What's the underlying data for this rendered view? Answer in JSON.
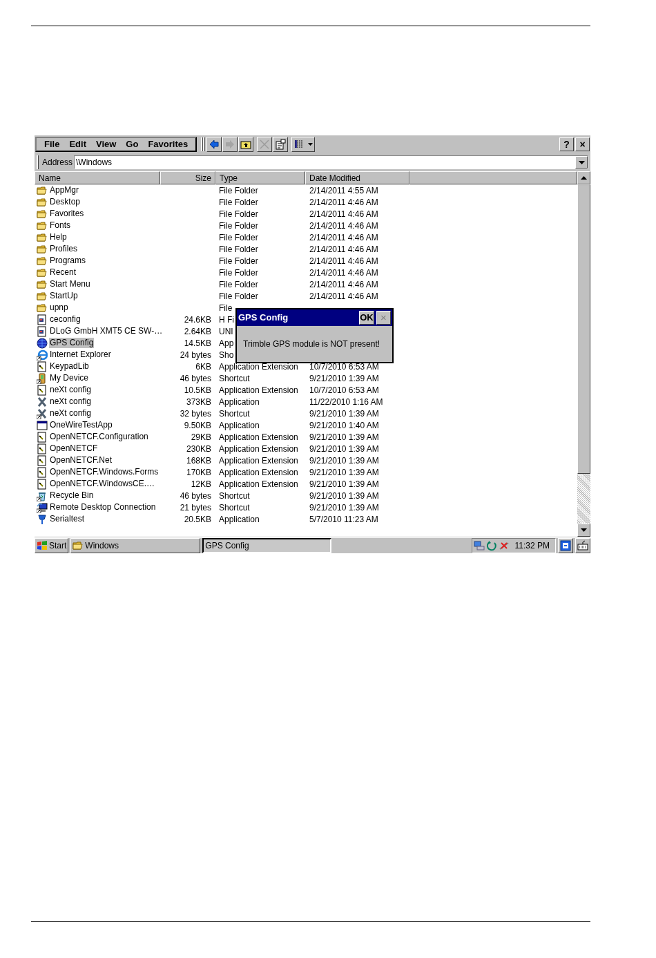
{
  "menu": [
    "File",
    "Edit",
    "View",
    "Go",
    "Favorites"
  ],
  "toolbar": [
    {
      "kind": "back",
      "disabled": false
    },
    {
      "kind": "forward",
      "disabled": true
    },
    {
      "kind": "up",
      "disabled": false
    },
    {
      "kind": "delete",
      "disabled": true
    },
    {
      "kind": "properties",
      "disabled": false
    },
    {
      "kind": "views",
      "disabled": false
    }
  ],
  "window_buttons": [
    "?",
    "×"
  ],
  "address": {
    "label": "Address",
    "value": "\\Windows"
  },
  "columns": [
    "Name",
    "Size",
    "Type",
    "Date Modified"
  ],
  "rows": [
    {
      "kind": "folder",
      "shortcut": false,
      "selected": false,
      "name": "AppMgr",
      "type": "File Folder",
      "date": "2/14/2011 4:55 AM"
    },
    {
      "kind": "folder",
      "shortcut": false,
      "selected": false,
      "name": "Desktop",
      "type": "File Folder",
      "date": "2/14/2011 4:46 AM"
    },
    {
      "kind": "folder",
      "shortcut": false,
      "selected": false,
      "name": "Favorites",
      "type": "File Folder",
      "date": "2/14/2011 4:46 AM"
    },
    {
      "kind": "folder",
      "shortcut": false,
      "selected": false,
      "name": "Fonts",
      "type": "File Folder",
      "date": "2/14/2011 4:46 AM"
    },
    {
      "kind": "folder",
      "shortcut": false,
      "selected": false,
      "name": "Help",
      "type": "File Folder",
      "date": "2/14/2011 4:46 AM"
    },
    {
      "kind": "folder",
      "shortcut": false,
      "selected": false,
      "name": "Profiles",
      "type": "File Folder",
      "date": "2/14/2011 4:46 AM"
    },
    {
      "kind": "folder",
      "shortcut": false,
      "selected": false,
      "name": "Programs",
      "type": "File Folder",
      "date": "2/14/2011 4:46 AM"
    },
    {
      "kind": "folder",
      "shortcut": false,
      "selected": false,
      "name": "Recent",
      "type": "File Folder",
      "date": "2/14/2011 4:46 AM"
    },
    {
      "kind": "folder",
      "shortcut": false,
      "selected": false,
      "name": "Start Menu",
      "type": "File Folder",
      "date": "2/14/2011 4:46 AM"
    },
    {
      "kind": "folder",
      "shortcut": false,
      "selected": false,
      "name": "StartUp",
      "type": "File Folder",
      "date": "2/14/2011 4:46 AM"
    },
    {
      "kind": "folder",
      "shortcut": false,
      "selected": false,
      "name": "upnp",
      "type": "File"
    },
    {
      "kind": "document",
      "shortcut": false,
      "selected": false,
      "name": "ceconfig",
      "size": "24.6KB",
      "type": "H Fi"
    },
    {
      "kind": "document",
      "shortcut": false,
      "selected": false,
      "name": "DLoG GmbH XMT5 CE SW-…",
      "size": "2.64KB",
      "type": "UNI"
    },
    {
      "kind": "globe",
      "shortcut": false,
      "selected": true,
      "name": "GPS Config",
      "size": "14.5KB",
      "type": "App"
    },
    {
      "kind": "browser",
      "shortcut": true,
      "selected": false,
      "name": "Internet Explorer",
      "size": "24 bytes",
      "type": "Sho"
    },
    {
      "kind": "extension",
      "shortcut": false,
      "selected": false,
      "name": "KeypadLib",
      "size": "6KB",
      "type": "Application Extension",
      "date": "10/7/2010 6:53 AM"
    },
    {
      "kind": "device",
      "shortcut": true,
      "selected": false,
      "name": "My Device",
      "size": "46 bytes",
      "type": "Shortcut",
      "date": "9/21/2010 1:39 AM"
    },
    {
      "kind": "extension",
      "shortcut": false,
      "selected": false,
      "name": "neXt config",
      "size": "10.5KB",
      "type": "Application Extension",
      "date": "10/7/2010 6:53 AM"
    },
    {
      "kind": "x-app",
      "shortcut": false,
      "selected": false,
      "name": "neXt config",
      "size": "373KB",
      "type": "Application",
      "date": "11/22/2010 1:16 AM"
    },
    {
      "kind": "x-app",
      "shortcut": true,
      "selected": false,
      "name": "neXt config",
      "size": "32 bytes",
      "type": "Shortcut",
      "date": "9/21/2010 1:39 AM"
    },
    {
      "kind": "window",
      "shortcut": false,
      "selected": false,
      "name": "OneWireTestApp",
      "size": "9.50KB",
      "type": "Application",
      "date": "9/21/2010 1:40 AM"
    },
    {
      "kind": "extension",
      "shortcut": false,
      "selected": false,
      "name": "OpenNETCF.Configuration",
      "size": "29KB",
      "type": "Application Extension",
      "date": "9/21/2010 1:39 AM"
    },
    {
      "kind": "extension",
      "shortcut": false,
      "selected": false,
      "name": "OpenNETCF",
      "size": "230KB",
      "type": "Application Extension",
      "date": "9/21/2010 1:39 AM"
    },
    {
      "kind": "extension",
      "shortcut": false,
      "selected": false,
      "name": "OpenNETCF.Net",
      "size": "168KB",
      "type": "Application Extension",
      "date": "9/21/2010 1:39 AM"
    },
    {
      "kind": "extension",
      "shortcut": false,
      "selected": false,
      "name": "OpenNETCF.Windows.Forms",
      "size": "170KB",
      "type": "Application Extension",
      "date": "9/21/2010 1:39 AM"
    },
    {
      "kind": "extension",
      "shortcut": false,
      "selected": false,
      "name": "OpenNETCF.WindowsCE.…",
      "size": "12KB",
      "type": "Application Extension",
      "date": "9/21/2010 1:39 AM"
    },
    {
      "kind": "bin",
      "shortcut": true,
      "selected": false,
      "name": "Recycle Bin",
      "size": "46 bytes",
      "type": "Shortcut",
      "date": "9/21/2010 1:39 AM"
    },
    {
      "kind": "remote",
      "shortcut": true,
      "selected": false,
      "name": "Remote Desktop Connection",
      "size": "21 bytes",
      "type": "Shortcut",
      "date": "9/21/2010 1:39 AM"
    },
    {
      "kind": "plug",
      "shortcut": false,
      "selected": false,
      "name": "Serialtest",
      "size": "20.5KB",
      "type": "Application",
      "date": "5/7/2010 11:23 AM"
    }
  ],
  "dialog": {
    "title": "GPS Config",
    "ok": "OK",
    "close": "×",
    "message": "Trimble GPS module is NOT present!"
  },
  "taskbar": {
    "start": "Start",
    "tasks": [
      {
        "label": "Windows",
        "icon": true,
        "selected": false
      },
      {
        "label": "GPS Config",
        "icon": false,
        "selected": true
      }
    ],
    "clock": "11:32 PM"
  }
}
